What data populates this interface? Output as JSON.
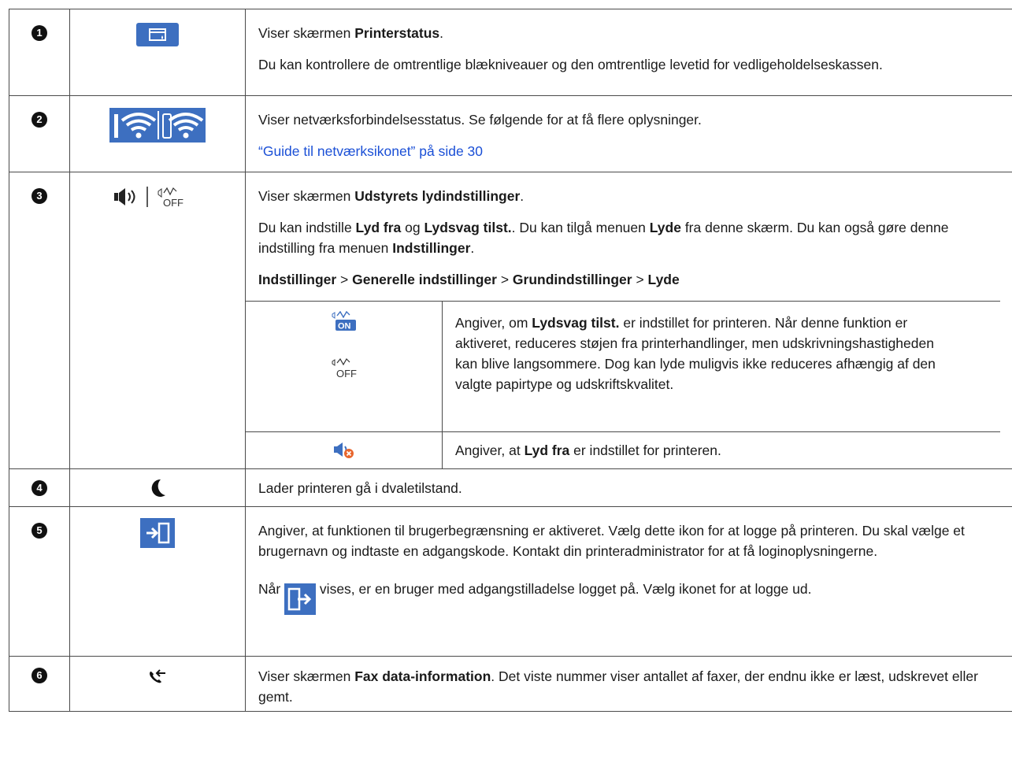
{
  "rows": [
    {
      "number": "1",
      "icon": "printer-status-icon",
      "lines": [
        {
          "text": "Viser skærmen ",
          "bold": "Printerstatus",
          "tail": "."
        },
        {
          "text": "Du kan kontrollere de omtrentlige blækniveauer og den omtrentlige levetid for vedligeholdelseskassen."
        }
      ]
    },
    {
      "number": "2",
      "icon": "network-status-icons",
      "text": "Viser netværksforbindelsesstatus. Se følgende for at få flere oplysninger.",
      "link": "“Guide til netværksikonet” på side 30"
    },
    {
      "number": "3",
      "icon": "speaker-and-quiet-off-icons",
      "line1": {
        "text": "Viser skærmen ",
        "bold": "Udstyrets lydindstillinger",
        "tail": "."
      },
      "line2": {
        "t1": "Du kan indstille ",
        "b1": "Lyd fra",
        "t2": " og ",
        "b2": "Lydsvag tilst.",
        "t3": ". Du kan tilgå menuen ",
        "b3": "Lyde",
        "t4": " fra denne skærm. Du kan også gøre denne indstilling fra menuen ",
        "b4": "Indstillinger",
        "t5": "."
      },
      "path": {
        "p1": "Indstillinger",
        "sep": " > ",
        "p2": "Generelle indstillinger",
        "p3": "Grundindstillinger",
        "p4": "Lyde"
      },
      "subrows": [
        {
          "icons": [
            "quiet-mode-on-icon",
            "quiet-mode-off-icon"
          ],
          "t1": "Angiver, om ",
          "b1": "Lydsvag tilst.",
          "t2": " er indstillet for printeren. Når denne funktion er aktiveret, reduceres støjen fra printerhandlinger, men udskrivningshastigheden kan blive langsommere. Dog kan lyde muligvis ikke reduceres afhængig af den valgte papirtype og udskriftskvalitet."
        },
        {
          "icons": [
            "sound-off-icon"
          ],
          "t1": "Angiver, at ",
          "b1": "Lyd fra",
          "t2": " er indstillet for printeren."
        }
      ]
    },
    {
      "number": "4",
      "icon": "sleep-moon-icon",
      "text": "Lader printeren gå i dvaletilstand."
    },
    {
      "number": "5",
      "icon": "login-icon",
      "text": "Angiver, at funktionen til brugerbegrænsning er aktiveret. Vælg dette ikon for at logge på printeren. Du skal vælge et brugernavn og indtaste en adgangskode. Kontakt din printeradministrator for at få loginoplysningerne.",
      "t2a": "Når ",
      "t2icon": "logout-icon",
      "t2b": " vises, er en bruger med adgangstilladelse logget på. Vælg ikonet for at logge ud."
    },
    {
      "number": "6",
      "icon": "fax-data-icon",
      "t1": "Viser skærmen ",
      "b1": "Fax data-information",
      "t2": ". Det viste nummer viser antallet af faxer, der endnu ikke er læst, udskrevet eller gemt."
    }
  ],
  "colors": {
    "icon_blue": "#3d6fc0",
    "link": "#1a4fd6",
    "border": "#4a4a4a",
    "badge": "#111111"
  }
}
